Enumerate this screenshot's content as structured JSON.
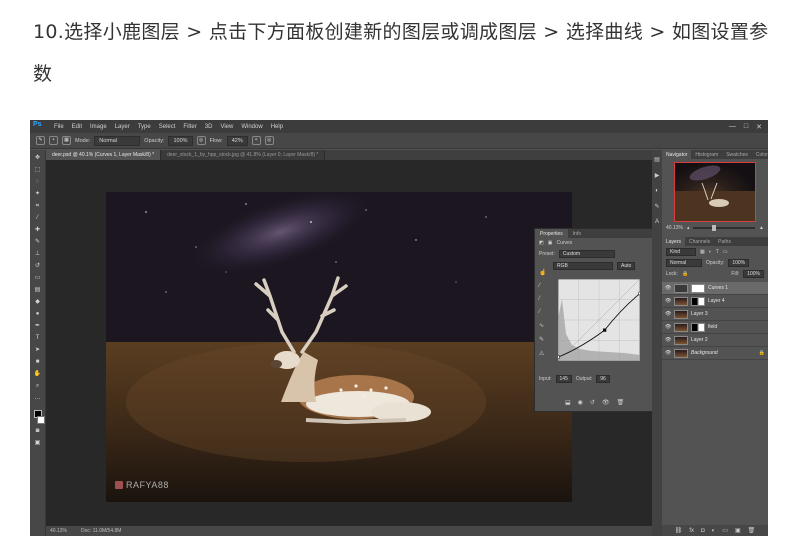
{
  "article": {
    "instruction": "10.选择小鹿图层 > 点击下方面板创建新的图层或调成图层 > 选择曲线 > 如图设置参数"
  },
  "colors": {
    "ps_bg": "#535353",
    "accent_blue": "#31a8ff",
    "nav_border": "#d83c3c"
  },
  "menubar": {
    "logo": "Ps",
    "items": [
      "File",
      "Edit",
      "Image",
      "Layer",
      "Type",
      "Select",
      "Filter",
      "3D",
      "View",
      "Window",
      "Help"
    ],
    "min": "—",
    "restore": "□",
    "close": "✕"
  },
  "options": {
    "mode_label": "Mode:",
    "mode_value": "Normal",
    "opacity_label": "Opacity:",
    "opacity_value": "100%",
    "flow_label": "Flow:",
    "flow_value": "42%"
  },
  "tabs": [
    {
      "label": "deer.psd @ 40.1% (Curves 1, Layer Mask/8) *"
    },
    {
      "label": "deer_stock_1_by_hpp_stock.jpg @ 41.8% (Layer 0, Layer Mask/8) *"
    }
  ],
  "status": {
    "zoom": "40.13%",
    "doc": "Doc: 11.0M/54.8M"
  },
  "watermark": {
    "text": "RAFYA88"
  },
  "properties": {
    "tab_properties": "Properties",
    "tab_info": "Info",
    "title": "Curves",
    "preset_label": "Preset:",
    "preset_value": "Custom",
    "channel_value": "RGB",
    "auto": "Auto",
    "input_label": "Input:",
    "input_value": "145",
    "output_label": "Output:",
    "output_value": "96"
  },
  "curve": {
    "points": [
      [
        0,
        12
      ],
      [
        145,
        96
      ],
      [
        255,
        210
      ]
    ]
  },
  "navigator": {
    "tabs": [
      "Navigator",
      "Histogram",
      "Swatches",
      "Color"
    ],
    "zoom": "40.13%"
  },
  "layers": {
    "tabs": [
      "Layers",
      "Channels",
      "Paths"
    ],
    "filter_value": "Kind",
    "blend_value": "Normal",
    "opacity_label": "Opacity:",
    "opacity_value": "100%",
    "lock_label": "Lock:",
    "fill_label": "Fill:",
    "fill_value": "100%",
    "rows": [
      {
        "name": "Curves 1",
        "thumb": "curve-adj",
        "sel": true,
        "mask": "mask-white"
      },
      {
        "name": "Layer 4",
        "thumb": "photo",
        "sel": false,
        "mask": "mask-mix"
      },
      {
        "name": "Layer 3",
        "thumb": "photo",
        "sel": false,
        "mask": ""
      },
      {
        "name": "field",
        "thumb": "photo",
        "sel": false,
        "mask": "mask-mix"
      },
      {
        "name": "Layer 2",
        "thumb": "photo",
        "sel": false,
        "mask": ""
      },
      {
        "name": "Background",
        "thumb": "photo",
        "sel": false,
        "mask": "",
        "italic": true
      }
    ]
  }
}
